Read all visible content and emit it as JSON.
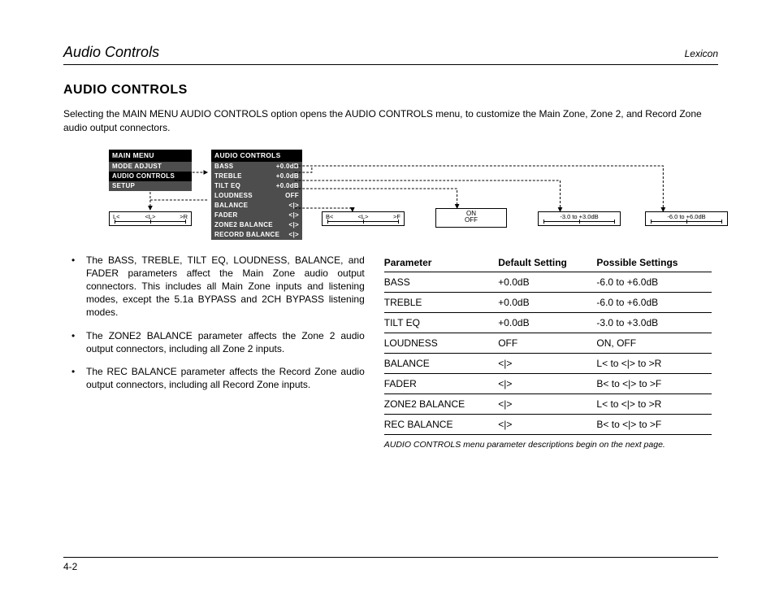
{
  "header": {
    "left": "Audio Controls",
    "right": "Lexicon"
  },
  "title": "AUDIO CONTROLS",
  "intro": "Selecting the MAIN MENU AUDIO CONTROLS option opens the AUDIO CONTROLS menu, to customize the Main Zone, Zone 2, and Record Zone audio output connectors.",
  "diagram": {
    "main_menu": {
      "title": "MAIN MENU",
      "items": [
        "MODE ADJUST",
        "AUDIO CONTROLS",
        "SETUP"
      ],
      "selected_index": 1
    },
    "audio_menu": {
      "title": "AUDIO CONTROLS",
      "rows": [
        {
          "label": "BASS",
          "value": "+0.0dB"
        },
        {
          "label": "TREBLE",
          "value": "+0.0dB"
        },
        {
          "label": "TILT EQ",
          "value": "+0.0dB"
        },
        {
          "label": "LOUDNESS",
          "value": "OFF"
        },
        {
          "label": "BALANCE",
          "value": "<|>"
        },
        {
          "label": "FADER",
          "value": "<|>"
        },
        {
          "label": "ZONE2 BALANCE",
          "value": "<|>"
        },
        {
          "label": "RECORD BALANCE",
          "value": "<|>"
        }
      ]
    },
    "slider_left": {
      "l": "L<",
      "c": "<L>",
      "r": ">R"
    },
    "slider_mid": {
      "l": "B<",
      "c": "<L>",
      "r": ">F"
    },
    "onoff": {
      "a": "ON",
      "b": "OFF"
    },
    "range1": "-3.0 to +3.0dB",
    "range2": "-6.0 to +6.0dB"
  },
  "bullets": [
    "The BASS, TREBLE, TILT EQ, LOUDNESS, BALANCE, and FADER parameters affect the Main Zone audio output connectors. This includes all Main Zone inputs and listening modes, except the 5.1a BYPASS and 2CH BYPASS listening modes.",
    "The ZONE2 BALANCE parameter affects the Zone 2 audio output connectors, including all Zone 2 inputs.",
    "The REC BALANCE parameter affects the Record Zone audio output connectors, including all Record Zone inputs."
  ],
  "table": {
    "headers": [
      "Parameter",
      "Default Setting",
      "Possible Settings"
    ],
    "rows": [
      [
        "BASS",
        "+0.0dB",
        "-6.0 to +6.0dB"
      ],
      [
        "TREBLE",
        "+0.0dB",
        "-6.0 to +6.0dB"
      ],
      [
        "TILT EQ",
        "+0.0dB",
        "-3.0 to +3.0dB"
      ],
      [
        "LOUDNESS",
        "OFF",
        "ON, OFF"
      ],
      [
        "BALANCE",
        "<|>",
        "L< to <|> to >R"
      ],
      [
        "FADER",
        "<|>",
        "B< to <|> to >F"
      ],
      [
        "ZONE2 BALANCE",
        "<|>",
        "L< to <|> to >R"
      ],
      [
        "REC BALANCE",
        "<|>",
        "B< to <|> to >F"
      ]
    ],
    "footnote": "AUDIO CONTROLS menu parameter descriptions begin on the next page."
  },
  "page_number": "4-2"
}
